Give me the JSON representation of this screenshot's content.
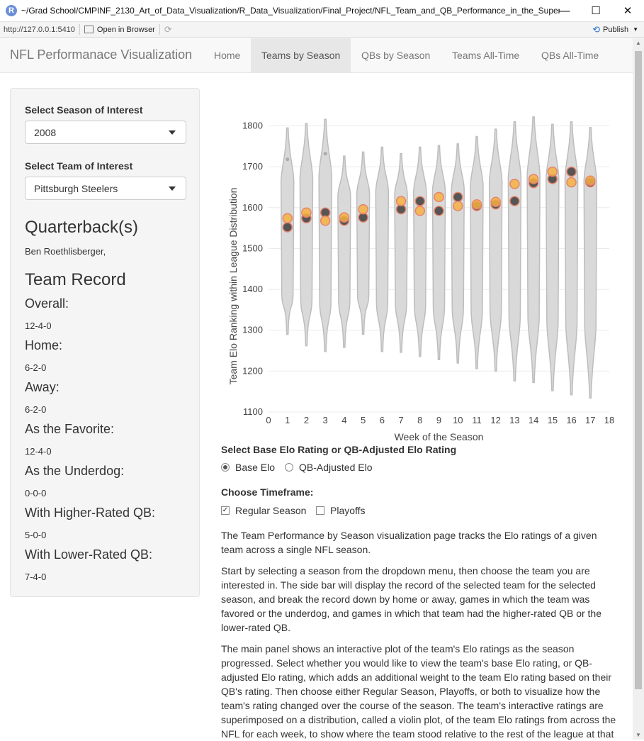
{
  "window": {
    "title": "~/Grad School/CMPINF_2130_Art_of_Data_Visualization/R_Data_Visualization/Final_Project/NFL_Team_and_QB_Performance_in_the_Super_...",
    "app_icon": "R",
    "minimize": "—",
    "maximize": "☐",
    "close": "✕"
  },
  "addressbar": {
    "url": "http://127.0.0.1:5410",
    "open_in_browser": "Open in Browser",
    "publish": "Publish"
  },
  "navbar": {
    "brand": "NFL Performanace Visualization",
    "tabs": [
      {
        "label": "Home"
      },
      {
        "label": "Teams by Season"
      },
      {
        "label": "QBs by Season"
      },
      {
        "label": "Teams All-Time"
      },
      {
        "label": "QBs All-Time"
      }
    ],
    "active_tab": "Teams by Season"
  },
  "sidebar": {
    "season_label": "Select Season of Interest",
    "season_value": "2008",
    "team_label": "Select Team of Interest",
    "team_value": "Pittsburgh Steelers",
    "qb_heading": "Quarterback(s)",
    "qb_names": "Ben Roethlisberger,",
    "record_heading": "Team Record",
    "records": [
      {
        "label": "Overall:",
        "value": "12-4-0"
      },
      {
        "label": "Home:",
        "value": "6-2-0"
      },
      {
        "label": "Away:",
        "value": "6-2-0"
      },
      {
        "label": "As the Favorite:",
        "value": "12-4-0"
      },
      {
        "label": "As the Underdog:",
        "value": "0-0-0"
      },
      {
        "label": "With Higher-Rated QB:",
        "value": "5-0-0"
      },
      {
        "label": "With Lower-Rated QB:",
        "value": "7-4-0"
      }
    ]
  },
  "controls": {
    "elo_label": "Select Base Elo Rating or QB-Adjusted Elo Rating",
    "elo_options": [
      "Base Elo",
      "QB-Adjusted Elo"
    ],
    "elo_selected": "Base Elo",
    "timeframe_label": "Choose Timeframe:",
    "timeframe_options": [
      "Regular Season",
      "Playoffs"
    ],
    "timeframe_checked": [
      "Regular Season"
    ]
  },
  "description": [
    "The Team Performance by Season visualization page tracks the Elo ratings of a given team across a single NFL season.",
    "Start by selecting a season from the dropdown menu, then choose the team you are interested in. The side bar will display the record of the selected team for the selected season, and break the record down by home or away, games in which the team was favored or the underdog, and games in which that team had the higher-rated QB or the lower-rated QB.",
    "The main panel shows an interactive plot of the team's Elo ratings as the season progressed. Select whether you would like to view the team's base Elo rating, or QB-adjusted Elo rating, which adds an additional weight to the team Elo rating based on their QB's rating. Then choose either Regular Season, Playoffs, or both to visualize how the team's rating changed over the course of the season. The team's interactive ratings are superimposed on a distribution, called a violin plot, of the team Elo ratings from across the NFL for each week, to show where the team stood relative to the rest of the league at that"
  ],
  "colors": {
    "violin_fill": "#d9d9d9",
    "violin_stroke": "#bdbdbd",
    "pre_game_point": "#f5b041",
    "pre_game_outline": "#e8836a",
    "post_game_point": "#555555"
  },
  "chart_data": {
    "type": "violin",
    "xlabel": "Week of the Season",
    "ylabel": "Team Elo Ranking within League Distribution",
    "xlim": [
      0,
      18
    ],
    "ylim": [
      1100,
      1820
    ],
    "xticks": [
      0,
      1,
      2,
      3,
      4,
      5,
      6,
      7,
      8,
      9,
      10,
      11,
      12,
      13,
      14,
      15,
      16,
      17,
      18
    ],
    "yticks": [
      1100,
      1200,
      1300,
      1400,
      1500,
      1600,
      1700,
      1800
    ],
    "violins": [
      {
        "week": 1,
        "min": 1290,
        "max": 1795,
        "median": 1500
      },
      {
        "week": 2,
        "min": 1262,
        "max": 1806,
        "median": 1500
      },
      {
        "week": 3,
        "min": 1248,
        "max": 1816,
        "median": 1500
      },
      {
        "week": 4,
        "min": 1258,
        "max": 1726,
        "median": 1500
      },
      {
        "week": 5,
        "min": 1290,
        "max": 1736,
        "median": 1500
      },
      {
        "week": 6,
        "min": 1248,
        "max": 1748,
        "median": 1500
      },
      {
        "week": 7,
        "min": 1246,
        "max": 1732,
        "median": 1500
      },
      {
        "week": 8,
        "min": 1236,
        "max": 1748,
        "median": 1500
      },
      {
        "week": 9,
        "min": 1228,
        "max": 1752,
        "median": 1500
      },
      {
        "week": 10,
        "min": 1220,
        "max": 1756,
        "median": 1500
      },
      {
        "week": 11,
        "min": 1206,
        "max": 1774,
        "median": 1500
      },
      {
        "week": 12,
        "min": 1200,
        "max": 1792,
        "median": 1500
      },
      {
        "week": 13,
        "min": 1176,
        "max": 1810,
        "median": 1500
      },
      {
        "week": 14,
        "min": 1172,
        "max": 1822,
        "median": 1500
      },
      {
        "week": 15,
        "min": 1152,
        "max": 1804,
        "median": 1500
      },
      {
        "week": 16,
        "min": 1142,
        "max": 1810,
        "median": 1500
      },
      {
        "week": 17,
        "min": 1134,
        "max": 1796,
        "median": 1500
      }
    ],
    "outliers": [
      {
        "week": 1,
        "y": 1718
      },
      {
        "week": 3,
        "y": 1732
      }
    ],
    "series": [
      {
        "points": [
          {
            "week": 1,
            "y": 1574
          },
          {
            "week": 2,
            "y": 1588
          },
          {
            "week": 3,
            "y": 1568
          },
          {
            "week": 4,
            "y": 1576
          },
          {
            "week": 5,
            "y": 1596
          },
          {
            "week": 7,
            "y": 1616
          },
          {
            "week": 8,
            "y": 1592
          },
          {
            "week": 9,
            "y": 1626
          },
          {
            "week": 10,
            "y": 1604
          },
          {
            "week": 11,
            "y": 1608
          },
          {
            "week": 12,
            "y": 1614
          },
          {
            "week": 13,
            "y": 1658
          },
          {
            "week": 14,
            "y": 1670
          },
          {
            "week": 15,
            "y": 1688
          },
          {
            "week": 16,
            "y": 1662
          },
          {
            "week": 17,
            "y": 1666
          }
        ]
      },
      {
        "points": [
          {
            "week": 1,
            "y": 1552
          },
          {
            "week": 2,
            "y": 1574
          },
          {
            "week": 3,
            "y": 1588
          },
          {
            "week": 4,
            "y": 1568
          },
          {
            "week": 5,
            "y": 1576
          },
          {
            "week": 7,
            "y": 1596
          },
          {
            "week": 8,
            "y": 1616
          },
          {
            "week": 9,
            "y": 1592
          },
          {
            "week": 10,
            "y": 1626
          },
          {
            "week": 11,
            "y": 1604
          },
          {
            "week": 12,
            "y": 1608
          },
          {
            "week": 13,
            "y": 1616
          },
          {
            "week": 14,
            "y": 1660
          },
          {
            "week": 15,
            "y": 1670
          },
          {
            "week": 16,
            "y": 1688
          },
          {
            "week": 17,
            "y": 1662
          }
        ]
      }
    ]
  }
}
